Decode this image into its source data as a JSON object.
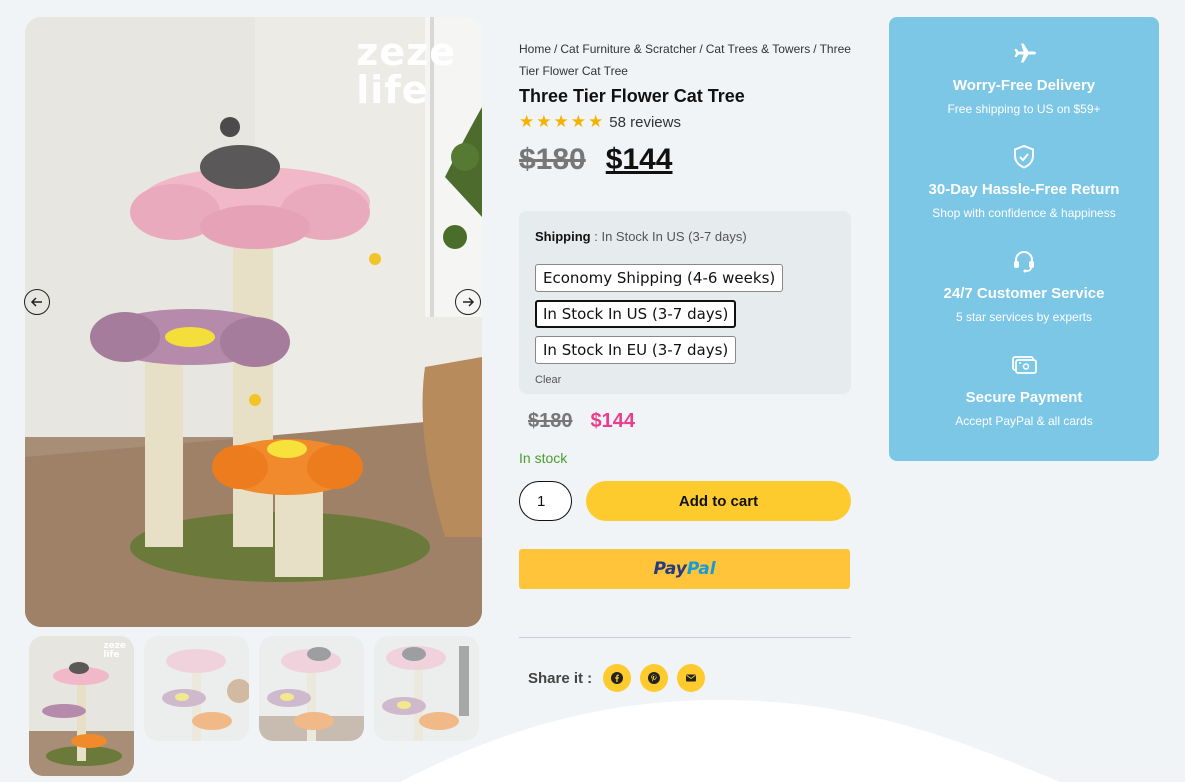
{
  "gallery": {
    "brand_logo_line1": "zeze",
    "brand_logo_line2": "life",
    "thumb_logo_line1": "zeze",
    "thumb_logo_line2": "life",
    "thumbnails": 4,
    "active_thumbnail": 1
  },
  "product": {
    "breadcrumb": [
      "Home",
      "Cat Furniture & Scratcher",
      "Cat Trees & Towers",
      "Three Tier Flower Cat Tree"
    ],
    "breadcrumb_separator": "/",
    "title": "Three Tier Flower Cat Tree",
    "rating_stars": 5,
    "reviews_label": "58 reviews",
    "old_price": "$180",
    "new_price": "$144"
  },
  "shipping": {
    "label": "Shipping",
    "colon": " : ",
    "selected_value": "In Stock In US (3-7 days)",
    "options": [
      "Economy Shipping (4-6 weeks)",
      "In Stock In US (3-7 days)",
      "In Stock In EU (3-7 days)"
    ],
    "clear_label": "Clear"
  },
  "variant": {
    "old_price": "$180",
    "new_price": "$144",
    "stock_status": "In stock"
  },
  "cart": {
    "quantity": "1",
    "add_to_cart_label": "Add to cart",
    "paypal_part1": "Pay",
    "paypal_part2": "Pal"
  },
  "share": {
    "label": "Share it :",
    "icons": [
      "facebook-icon",
      "pinterest-icon",
      "envelope-icon"
    ]
  },
  "features": [
    {
      "icon": "airplane-icon",
      "title": "Worry-Free Delivery",
      "subtitle": "Free shipping to US on $59+"
    },
    {
      "icon": "shield-check-icon",
      "title": "30-Day Hassle-Free Return",
      "subtitle": "Shop with confidence & happiness"
    },
    {
      "icon": "headset-icon",
      "title": "24/7 Customer Service",
      "subtitle": "5 star services by experts"
    },
    {
      "icon": "payment-card-icon",
      "title": "Secure Payment",
      "subtitle": "Accept PayPal & all cards"
    }
  ],
  "colors": {
    "page_bg": "#f0f4f7",
    "accent_yellow": "#fdcb2e",
    "feature_panel": "#7cc6e6",
    "sale_pink": "#e83e8c",
    "stock_green": "#4a9d2f"
  }
}
